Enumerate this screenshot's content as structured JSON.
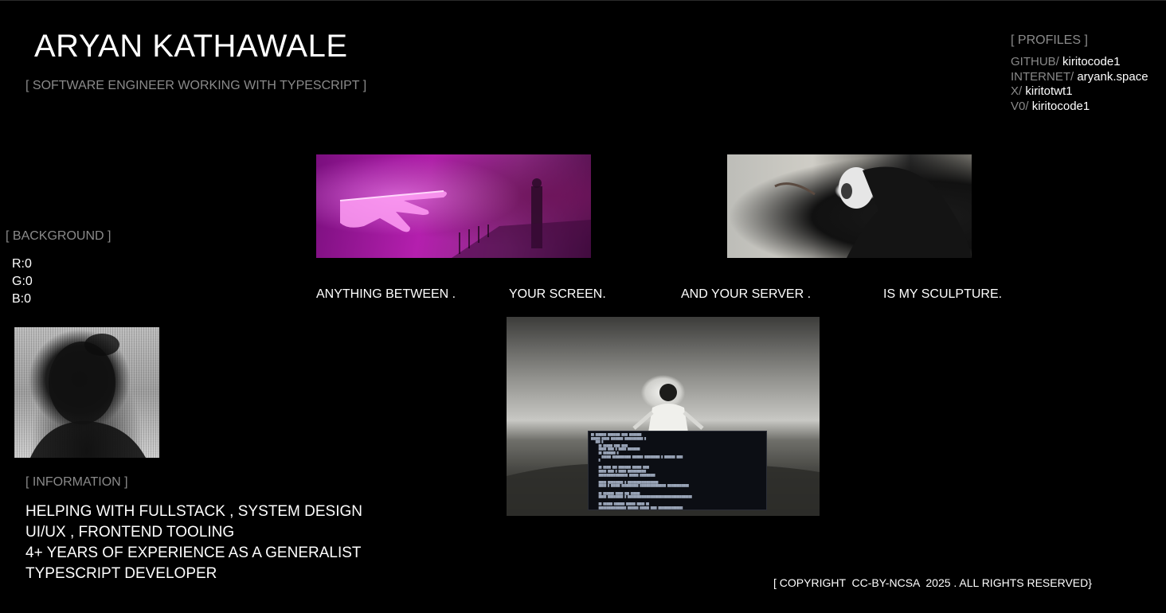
{
  "header": {
    "name": "ARYAN KATHAWALE",
    "role": "[ SOFTWARE ENGINEER WORKING WITH TYPESCRIPT ]"
  },
  "profiles": {
    "heading": "[ PROFILES ]",
    "items": [
      {
        "key": "GITHUB",
        "sep": "/ ",
        "value": "kiritocode1"
      },
      {
        "key": "INTERNET",
        "sep": "/ ",
        "value": "aryank.space"
      },
      {
        "key": "X",
        "sep": "/ ",
        "value": "kiritotwt1"
      },
      {
        "key": "V0",
        "sep": "/ ",
        "value": "kiritocode1"
      }
    ]
  },
  "background": {
    "heading": "[ BACKGROUND ]",
    "r": "R:0",
    "g": "G:0",
    "b": "B:0"
  },
  "tagline": {
    "part1": "ANYTHING BETWEEN .",
    "part2": "YOUR SCREEN.",
    "part3": "AND YOUR SERVER .",
    "part4": "IS MY SCULPTURE."
  },
  "information": {
    "heading": "[ INFORMATION ]",
    "lines": [
      "HELPING WITH FULLSTACK , SYSTEM DESIGN",
      "UI/UX , FRONTEND TOOLING",
      "4+ YEARS OF EXPERIENCE AS A GENERALIST",
      "TYPESCRIPT DEVELOPER"
    ]
  },
  "footer": {
    "copyright": "[ COPYRIGHT  CC-BY-NCSA  2025 . ALL RIGHTS RESERVED}"
  }
}
